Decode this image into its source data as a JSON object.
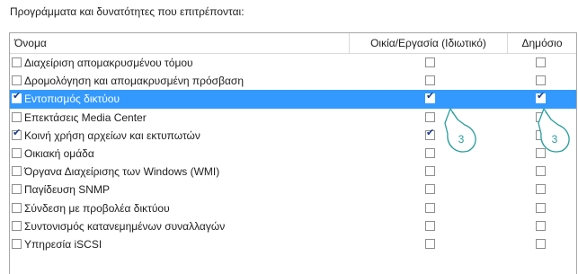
{
  "heading": "Προγράμματα και δυνατότητες που επιτρέπονται:",
  "columns": {
    "name": "Όνομα",
    "private": "Οικία/Εργασία (Ιδιωτικό)",
    "public": "Δημόσιο"
  },
  "rows": [
    {
      "label": "Διαχείριση απομακρυσμένου τόμου",
      "enabled": false,
      "private": false,
      "public": false,
      "selected": false
    },
    {
      "label": "Δρομολόγηση και απομακρυσμένη πρόσβαση",
      "enabled": false,
      "private": false,
      "public": false,
      "selected": false
    },
    {
      "label": "Εντοπισμός δικτύου",
      "enabled": true,
      "private": true,
      "public": true,
      "selected": true
    },
    {
      "label": "Επεκτάσεις Media Center",
      "enabled": false,
      "private": false,
      "public": false,
      "selected": false
    },
    {
      "label": "Κοινή χρήση αρχείων και εκτυπωτών",
      "enabled": true,
      "private": true,
      "public": false,
      "selected": false
    },
    {
      "label": "Οικιακή ομάδα",
      "enabled": false,
      "private": false,
      "public": false,
      "selected": false
    },
    {
      "label": "Όργανα Διαχείρισης των Windows (WMI)",
      "enabled": false,
      "private": false,
      "public": false,
      "selected": false
    },
    {
      "label": "Παγίδευση SNMP",
      "enabled": false,
      "private": false,
      "public": false,
      "selected": false
    },
    {
      "label": "Σύνδεση με προβολέα δικτύου",
      "enabled": false,
      "private": false,
      "public": false,
      "selected": false
    },
    {
      "label": "Συντονισμός κατανεμημένων συναλλαγών",
      "enabled": false,
      "private": false,
      "public": false,
      "selected": false
    },
    {
      "label": "Υπηρεσία iSCSI",
      "enabled": false,
      "private": false,
      "public": false,
      "selected": false
    }
  ],
  "callouts": {
    "private": "3",
    "public": "3"
  },
  "colors": {
    "selection": "#3399ff",
    "callout": "#2a9d9d",
    "check": "#1a3c8c"
  }
}
